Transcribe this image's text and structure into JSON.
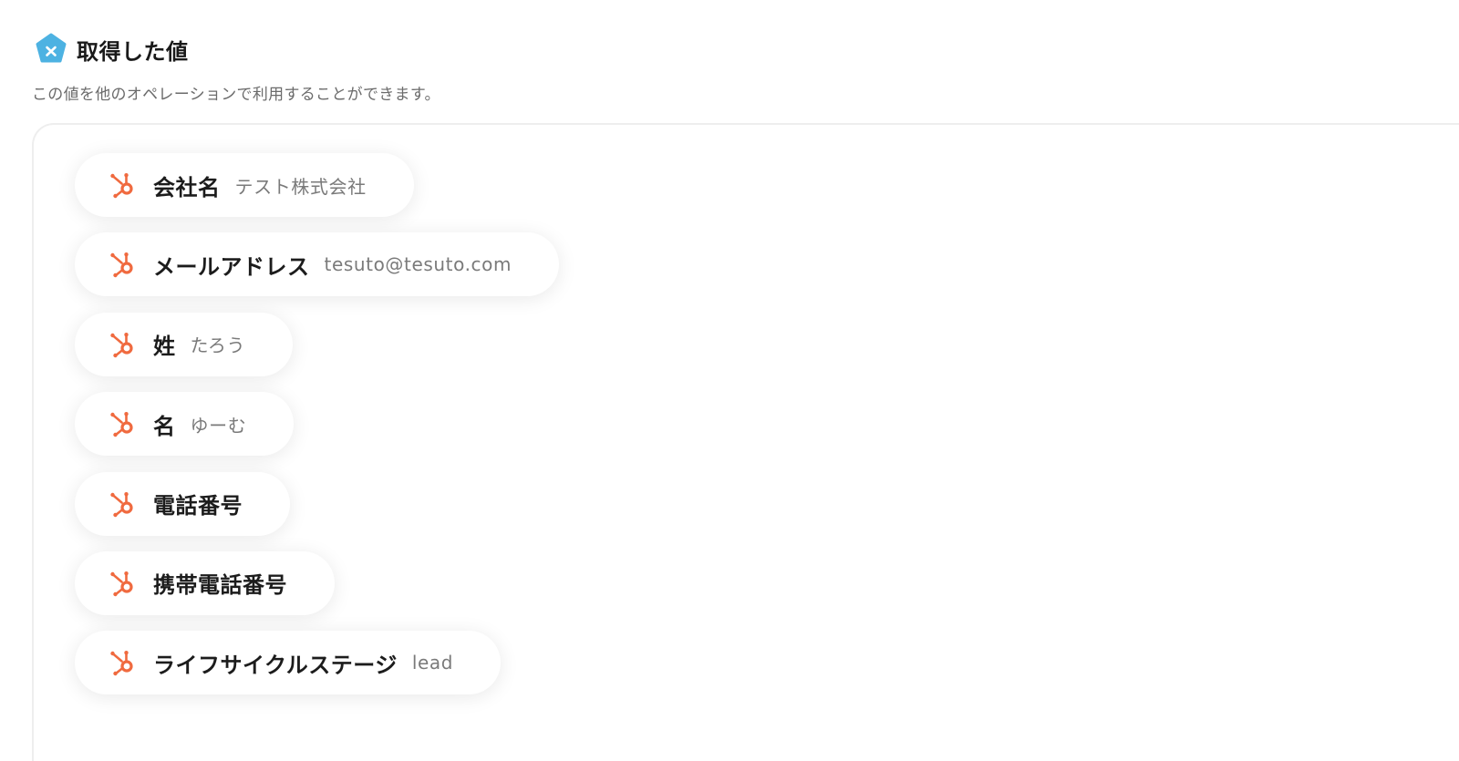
{
  "section": {
    "title": "取得した値",
    "description": "この値を他のオペレーションで利用することができます。",
    "header_icon": "variable-x-icon",
    "header_icon_color": "#4DB2E2"
  },
  "fields": [
    {
      "label": "会社名",
      "value": "テスト株式会社",
      "icon": "hubspot-icon"
    },
    {
      "label": "メールアドレス",
      "value": "tesuto@tesuto.com",
      "icon": "hubspot-icon"
    },
    {
      "label": "姓",
      "value": "たろう",
      "icon": "hubspot-icon"
    },
    {
      "label": "名",
      "value": "ゆーむ",
      "icon": "hubspot-icon"
    },
    {
      "label": "電話番号",
      "value": "",
      "icon": "hubspot-icon"
    },
    {
      "label": "携帯電話番号",
      "value": "",
      "icon": "hubspot-icon"
    },
    {
      "label": "ライフサイクルステージ",
      "value": "lead",
      "icon": "hubspot-icon"
    }
  ],
  "colors": {
    "hubspot_orange": "#F06A3F",
    "label_text": "#1C1C1C",
    "value_text": "#7A7A7A"
  }
}
